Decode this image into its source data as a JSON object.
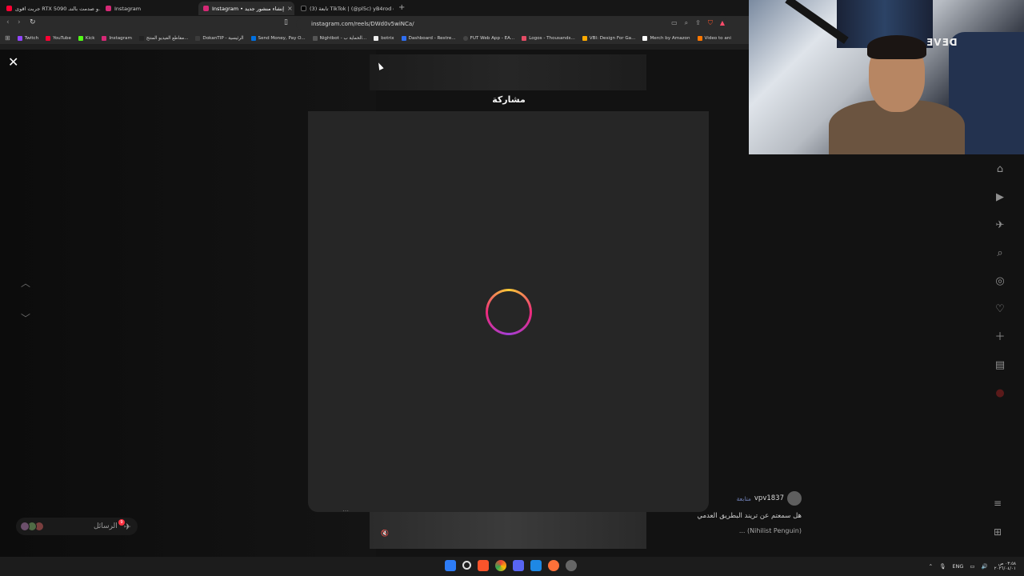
{
  "browser": {
    "tabs": [
      {
        "title": "جربت اقوى RTX 5090 و صدمت بالنتـ...",
        "active": false,
        "color": "#ff0033"
      },
      {
        "title": "Instagram",
        "active": false,
        "color": "#d62976"
      },
      {
        "title": "Instagram • إنشاء منشور جديد",
        "active": true,
        "color": "#d62976"
      },
      {
        "title": "تابعة (3) TikTok | (@pl5c) yB4rod ea",
        "active": false,
        "color": "#000000"
      }
    ],
    "new_tab": "+",
    "url": "instagram.com/reels/DWd0v5wiNCa/",
    "bookmarks": [
      {
        "label": "Twitch",
        "color": "#9146ff"
      },
      {
        "label": "YouTube",
        "color": "#ff0033"
      },
      {
        "label": "Kick",
        "color": "#53fc18"
      },
      {
        "label": "Instagram",
        "color": "#d62976"
      },
      {
        "label": "مقاطع الفيديو المنتج...",
        "color": "#222222"
      },
      {
        "label": "DokanTIP - الرئيسية",
        "color": "#3b3b3b"
      },
      {
        "label": "Send Money, Pay O...",
        "color": "#0070e0"
      },
      {
        "label": "Nightbot - الحماية ب...",
        "color": "#333333"
      },
      {
        "label": "botrix",
        "color": "#eeeeee"
      },
      {
        "label": "Dashboard - Restre...",
        "color": "#2f6ef0"
      },
      {
        "label": "FUT Web App - EA...",
        "color": "#444444"
      },
      {
        "label": "Logos - Thousands...",
        "color": "#e44c65"
      },
      {
        "label": "VBI: Design For Ga...",
        "color": "#ffaa00"
      },
      {
        "label": "Merch by Amazon",
        "color": "#ffffff"
      },
      {
        "label": "Video to ani",
        "color": "#ff7700"
      }
    ]
  },
  "modal": {
    "title": "مشاركة",
    "accent_gradient": [
      "#f9ce34",
      "#ee2a7b",
      "#a23fd6"
    ]
  },
  "messages": {
    "label": "الرسائل",
    "badge": "9"
  },
  "post": {
    "username": "vpv1837",
    "follow": "متابعة",
    "caption": "هل سمعتم عن تريند البطريق العدمي",
    "caption_more": "(Nihilist Penguin) ..."
  },
  "webcam": {
    "logo": "ƎVƎᗡ"
  },
  "taskbar": {
    "lang": "ENG",
    "time": "٠٣:٥٨ ص",
    "date": "٢٠٢٦/٠٤/٠١"
  }
}
